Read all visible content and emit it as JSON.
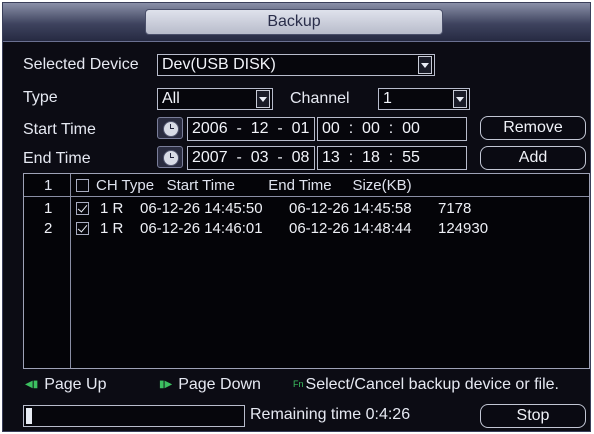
{
  "title": "Backup",
  "selected_device": {
    "label": "Selected Device",
    "value": "Dev(USB DISK)"
  },
  "type": {
    "label": "Type",
    "value": "All"
  },
  "channel": {
    "label": "Channel",
    "value": "1"
  },
  "start_time": {
    "label": "Start Time",
    "year": "2006",
    "month": "12",
    "day": "01",
    "hour": "00",
    "minute": "00",
    "second": "00"
  },
  "end_time": {
    "label": "End Time",
    "year": "2007",
    "month": "03",
    "day": "08",
    "hour": "13",
    "minute": "18",
    "second": "55"
  },
  "buttons": {
    "remove": "Remove",
    "add": "Add",
    "stop": "Stop"
  },
  "table": {
    "header_index": "1",
    "header_columns": "CH Type   Start Time        End Time     Size(KB)",
    "rows": [
      {
        "index": "1",
        "checked": true,
        "ch": "1 R",
        "start": "06-12-26 14:45:50",
        "end": "06-12-26 14:45:58",
        "size": "7178"
      },
      {
        "index": "2",
        "checked": true,
        "ch": "1 R",
        "start": "06-12-26 14:46:01",
        "end": "06-12-26 14:48:44",
        "size": "124930"
      }
    ]
  },
  "footer": {
    "page_up": "Page Up",
    "page_down": "Page Down",
    "fn_hint": "Select/Cancel backup device or file.",
    "fn_key": "Fn"
  },
  "progress": {
    "fraction": 0.03,
    "remaining_label": "Remaining time 0:4:26"
  },
  "colors": {
    "background": "#0c0c14",
    "title_gradient": "#3e435e",
    "accent_green": "#3cc060"
  }
}
